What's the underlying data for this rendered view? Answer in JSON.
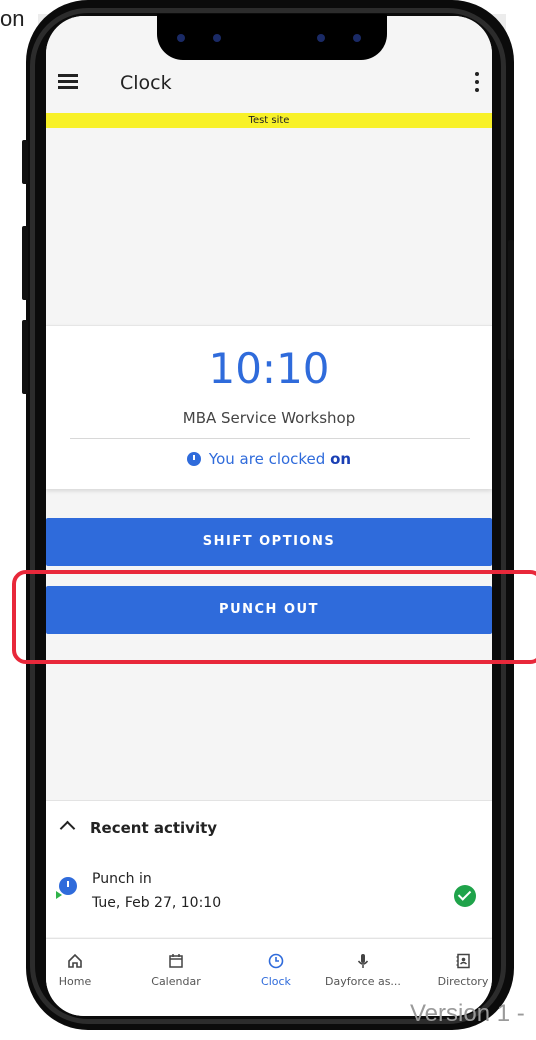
{
  "outside": {
    "corner_text": "on",
    "footer_text": "Version 1 -"
  },
  "appbar": {
    "title": "Clock"
  },
  "banner": {
    "text": "Test site"
  },
  "clock": {
    "time": "10:10",
    "location": "MBA Service Workshop",
    "status_prefix": "You are clocked ",
    "status_value": "on"
  },
  "actions": {
    "shift_options": "SHIFT OPTIONS",
    "punch_out": "PUNCH OUT"
  },
  "recent": {
    "title": "Recent activity",
    "items": [
      {
        "label": "Punch in",
        "time": "Tue, Feb 27, 10:10",
        "status": "success"
      }
    ]
  },
  "nav": {
    "items": [
      {
        "label": "Home",
        "icon": "home-icon"
      },
      {
        "label": "Calendar",
        "icon": "calendar-icon"
      },
      {
        "label": "Clock",
        "icon": "clock-icon",
        "active": true
      },
      {
        "label": "Dayforce as...",
        "icon": "microphone-icon"
      },
      {
        "label": "Directory",
        "icon": "directory-icon"
      }
    ]
  },
  "colors": {
    "accent": "#2f6bdb",
    "banner": "#f8f128",
    "highlight": "#e8283a",
    "success": "#1fa34a"
  }
}
